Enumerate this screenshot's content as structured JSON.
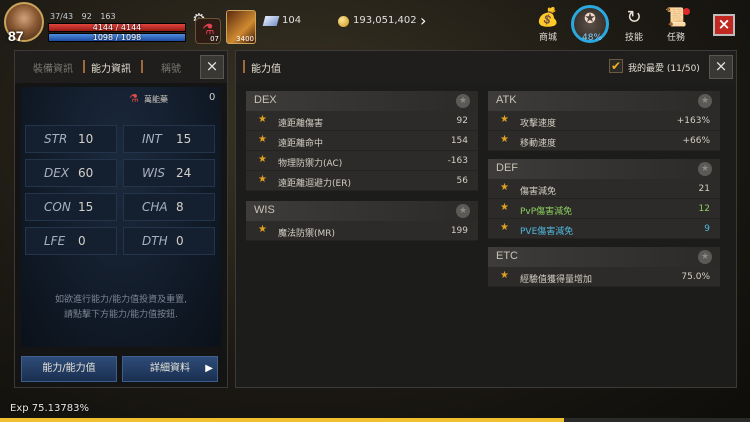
{
  "hud": {
    "level": "87",
    "hp_text": "4144 / 4144",
    "hp_fraction": 1.0,
    "mp_text": "1098 / 1098",
    "mp_fraction": 1.0,
    "buffs": [
      "37/43",
      "92",
      "163"
    ],
    "potion_qty": "07",
    "skill_qty": "3400",
    "gems": "104",
    "gold": "193,051,402",
    "menu": {
      "shop": "商城",
      "clock_pct": "48%",
      "skill": "技能",
      "quest": "任務"
    },
    "close_icon": "×"
  },
  "left_panel": {
    "tabs": [
      "裝備資訊",
      "能力資訊",
      "稱號"
    ],
    "active_tab": 1,
    "close_icon": "×",
    "elixir_label": "萬能藥",
    "elixir_value": "0",
    "stats": [
      {
        "name": "STR",
        "value": "10"
      },
      {
        "name": "INT",
        "value": "15"
      },
      {
        "name": "DEX",
        "value": "60"
      },
      {
        "name": "WIS",
        "value": "24"
      },
      {
        "name": "CON",
        "value": "15"
      },
      {
        "name": "CHA",
        "value": "8"
      },
      {
        "name": "LFE",
        "value": "0"
      },
      {
        "name": "DTH",
        "value": "0"
      }
    ],
    "reset_note_line1": "如欲進行能力/能力值投資及重置,",
    "reset_note_line2": "請點擊下方能力/能力值按鈕.",
    "button_stat_value": "能力/能力值",
    "button_detail": "詳細資料",
    "button_detail_arrow": "▶"
  },
  "right_panel": {
    "title": "能力值",
    "favorites_label": "我的最愛 (11/50)",
    "close_icon": "×",
    "groups": {
      "dex": {
        "name": "DEX",
        "rows": [
          {
            "label": "遠距離傷害",
            "value": "92"
          },
          {
            "label": "遠距離命中",
            "value": "154"
          },
          {
            "label": "物理防禦力(AC)",
            "value": "-163"
          },
          {
            "label": "遠距離迴避力(ER)",
            "value": "56"
          }
        ]
      },
      "wis": {
        "name": "WIS",
        "rows": [
          {
            "label": "魔法防禦(MR)",
            "value": "199"
          }
        ]
      },
      "atk": {
        "name": "ATK",
        "rows": [
          {
            "label": "攻擊速度",
            "value": "+163%"
          },
          {
            "label": "移動速度",
            "value": "+66%"
          }
        ]
      },
      "def": {
        "name": "DEF",
        "rows": [
          {
            "label": "傷害減免",
            "value": "21",
            "color": "default"
          },
          {
            "label": "PvP傷害減免",
            "value": "12",
            "color": "green"
          },
          {
            "label": "PVE傷害減免",
            "value": "9",
            "color": "cyan"
          }
        ]
      },
      "etc": {
        "name": "ETC",
        "rows": [
          {
            "label": "經驗值獲得量增加",
            "value": "75.0%"
          }
        ]
      }
    }
  },
  "footer": {
    "exp_text": "Exp 75.13783%",
    "exp_fraction": 0.7513783,
    "page_dots": 5,
    "active_dot": 0
  },
  "colors": {
    "accent_orange": "#a0683a",
    "star_gold": "#e0a020",
    "green": "#8cd060",
    "cyan": "#50b8e0",
    "hp_red": "#e0463e",
    "mp_blue": "#4f8fe0"
  }
}
